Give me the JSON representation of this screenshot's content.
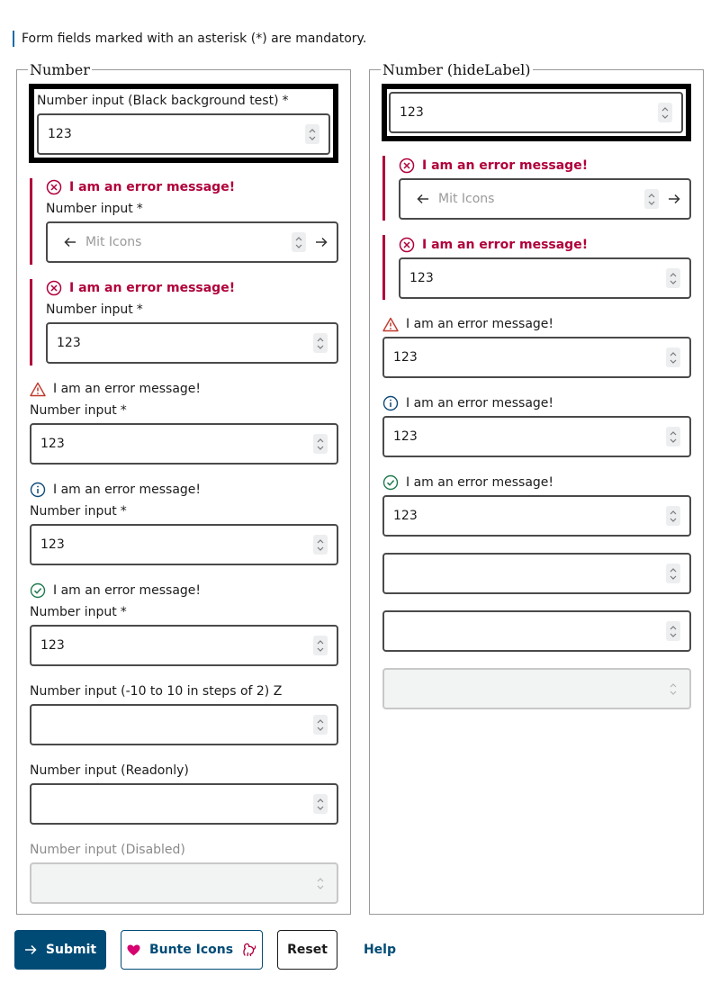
{
  "form": {
    "mandatory_note": "Form fields marked with an asterisk (*) are mandatory."
  },
  "left": {
    "legend": "Number",
    "black_test": {
      "label": "Number input (Black background test)",
      "value": "123"
    },
    "error_icons": {
      "message": "I am an error message!",
      "label": "Number input",
      "placeholder": "Mit Icons"
    },
    "error_plain": {
      "message": "I am an error message!",
      "label": "Number input",
      "value": "123"
    },
    "warning": {
      "message": "I am an error message!",
      "label": "Number input",
      "value": "123"
    },
    "info": {
      "message": "I am an error message!",
      "label": "Number input",
      "value": "123"
    },
    "success": {
      "message": "I am an error message!",
      "label": "Number input",
      "value": "123"
    },
    "stepped": {
      "label": "Number input (-10 to 10 in steps of 2) Z",
      "value": ""
    },
    "readonly": {
      "label": "Number input (Readonly)",
      "value": ""
    },
    "disabled": {
      "label": "Number input (Disabled)",
      "value": ""
    },
    "required_mark": "*"
  },
  "right": {
    "legend": "Number (hideLabel)",
    "black_test": {
      "value": "123"
    },
    "error_icons": {
      "message": "I am an error message!",
      "placeholder": "Mit Icons"
    },
    "error_plain": {
      "message": "I am an error message!",
      "value": "123"
    },
    "warning": {
      "message": "I am an error message!",
      "value": "123"
    },
    "info": {
      "message": "I am an error message!",
      "value": "123"
    },
    "success": {
      "message": "I am an error message!",
      "value": "123"
    }
  },
  "buttons": {
    "submit": "Submit",
    "colorful": "Bunte Icons",
    "reset": "Reset",
    "help": "Help"
  },
  "colors": {
    "error": "#b0003a",
    "warning": "#c0392b",
    "info": "#0e4a78",
    "success": "#1d7a4e",
    "primary": "#004b76",
    "accent": "#d6006f"
  },
  "icons": {
    "error": "circle-x-icon",
    "warning": "triangle-warning-icon",
    "info": "circle-info-icon",
    "success": "circle-check-icon",
    "arrow_left": "arrow-left-icon",
    "arrow_right": "arrow-right-icon",
    "heart": "heart-icon",
    "squirrel": "squirrel-icon"
  }
}
